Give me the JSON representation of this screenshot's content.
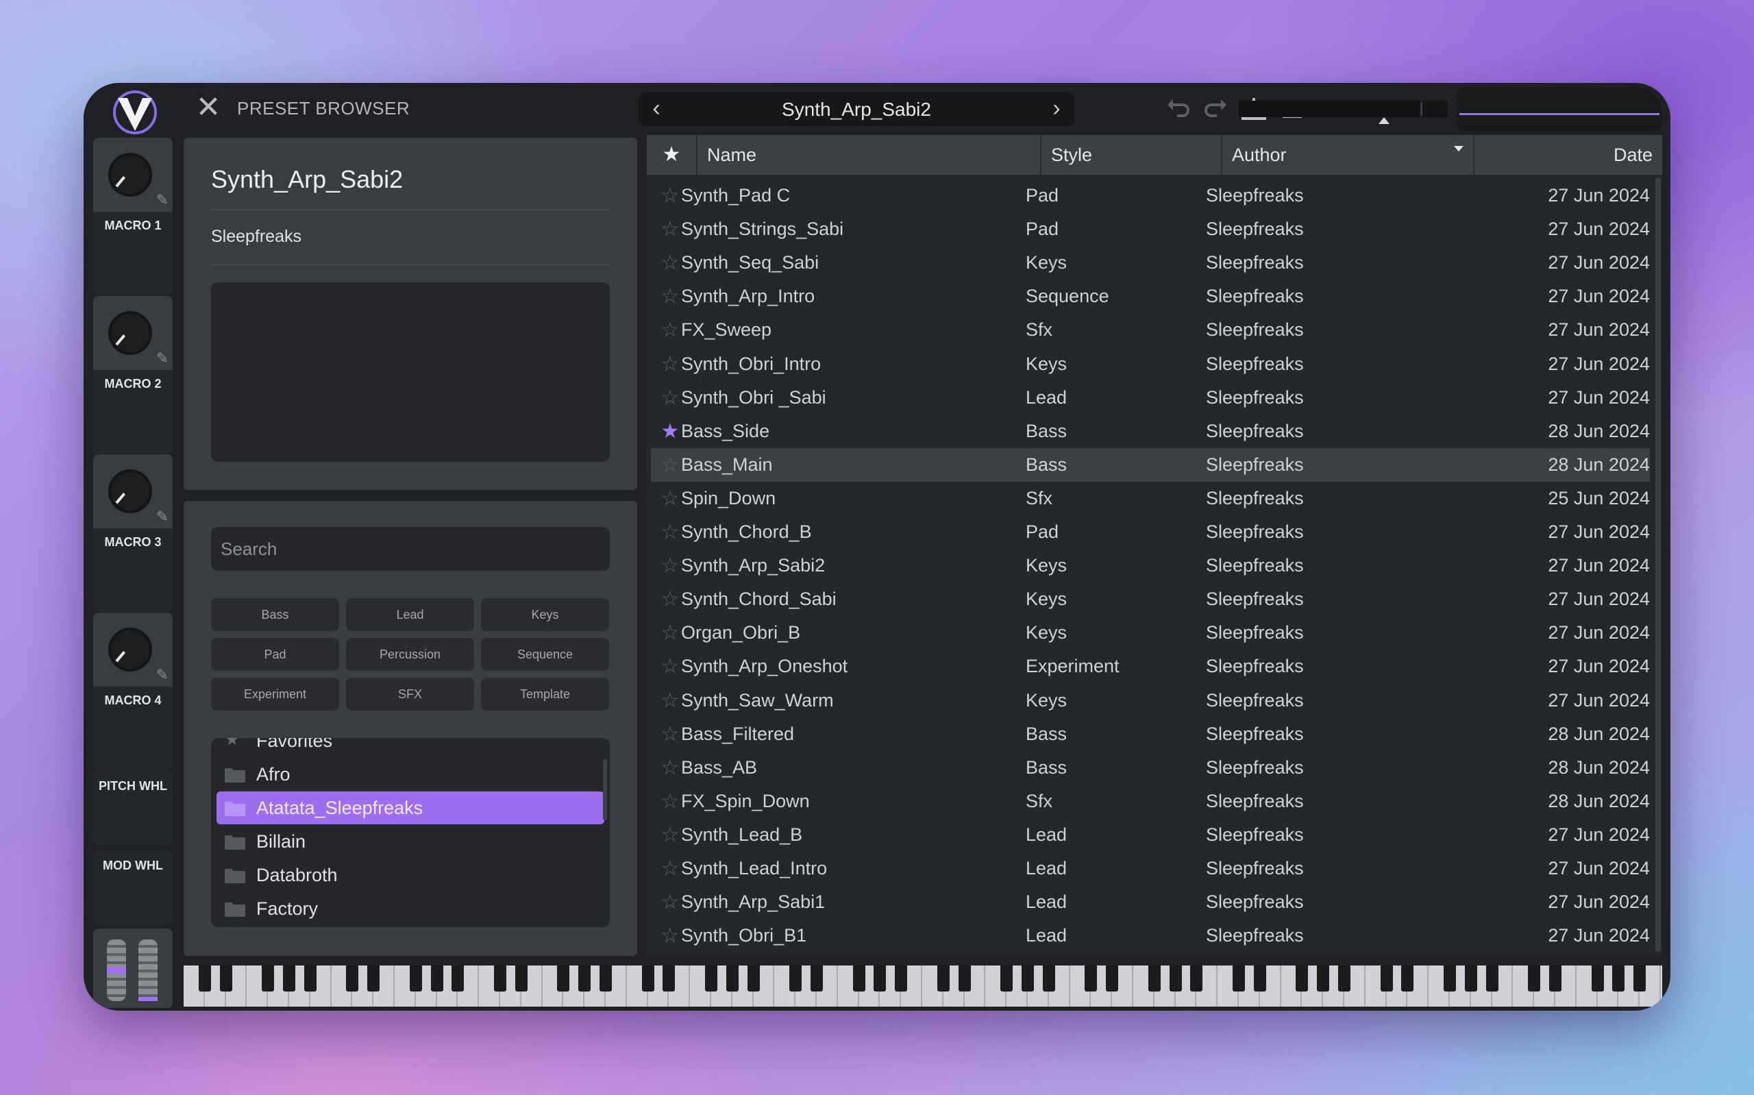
{
  "header": {
    "title": "PRESET BROWSER",
    "current_preset": "Synth_Arp_Sabi2",
    "icons": [
      "logo-icon",
      "close-icon",
      "chevron-left-icon",
      "chevron-right-icon",
      "undo-icon",
      "redo-icon",
      "save-icon",
      "menu-icon"
    ]
  },
  "macros": [
    {
      "label": "MACRO 1"
    },
    {
      "label": "MACRO 2"
    },
    {
      "label": "MACRO 3"
    },
    {
      "label": "MACRO 4"
    }
  ],
  "wheels": {
    "pitch": "PITCH WHL",
    "mod": "MOD WHL"
  },
  "info": {
    "name": "Synth_Arp_Sabi2",
    "author": "Sleepfreaks"
  },
  "search": {
    "placeholder": "Search"
  },
  "tags": [
    "Bass",
    "Lead",
    "Keys",
    "Pad",
    "Percussion",
    "Sequence",
    "Experiment",
    "SFX",
    "Template"
  ],
  "folders": [
    {
      "label": "Favorites",
      "selected": false
    },
    {
      "label": "Afro",
      "selected": false
    },
    {
      "label": "Atatata_Sleepfreaks",
      "selected": true
    },
    {
      "label": "Billain",
      "selected": false
    },
    {
      "label": "Databroth",
      "selected": false
    },
    {
      "label": "Factory",
      "selected": false
    }
  ],
  "table": {
    "columns": {
      "star": "★",
      "name": "Name",
      "style": "Style",
      "author": "Author",
      "date": "Date"
    },
    "rows": [
      {
        "fav": false,
        "name": "Synth_Pad C",
        "style": "Pad",
        "author": "Sleepfreaks",
        "date": "27 Jun 2024"
      },
      {
        "fav": false,
        "name": "Synth_Strings_Sabi",
        "style": "Pad",
        "author": "Sleepfreaks",
        "date": "27 Jun 2024"
      },
      {
        "fav": false,
        "name": "Synth_Seq_Sabi",
        "style": "Keys",
        "author": "Sleepfreaks",
        "date": "27 Jun 2024"
      },
      {
        "fav": false,
        "name": "Synth_Arp_Intro",
        "style": "Sequence",
        "author": "Sleepfreaks",
        "date": "27 Jun 2024"
      },
      {
        "fav": false,
        "name": "FX_Sweep",
        "style": "Sfx",
        "author": "Sleepfreaks",
        "date": "27 Jun 2024"
      },
      {
        "fav": false,
        "name": "Synth_Obri_Intro",
        "style": "Keys",
        "author": "Sleepfreaks",
        "date": "27 Jun 2024"
      },
      {
        "fav": false,
        "name": "Synth_Obri _Sabi",
        "style": "Lead",
        "author": "Sleepfreaks",
        "date": "27 Jun 2024"
      },
      {
        "fav": true,
        "name": "Bass_Side",
        "style": "Bass",
        "author": "Sleepfreaks",
        "date": "28 Jun 2024"
      },
      {
        "fav": false,
        "name": "Bass_Main",
        "style": "Bass",
        "author": "Sleepfreaks",
        "date": "28 Jun 2024",
        "selected": true
      },
      {
        "fav": false,
        "name": "Spin_Down",
        "style": "Sfx",
        "author": "Sleepfreaks",
        "date": "25 Jun 2024"
      },
      {
        "fav": false,
        "name": "Synth_Chord_B",
        "style": "Pad",
        "author": "Sleepfreaks",
        "date": "27 Jun 2024"
      },
      {
        "fav": false,
        "name": "Synth_Arp_Sabi2",
        "style": "Keys",
        "author": "Sleepfreaks",
        "date": "27 Jun 2024"
      },
      {
        "fav": false,
        "name": "Synth_Chord_Sabi",
        "style": "Keys",
        "author": "Sleepfreaks",
        "date": "27 Jun 2024"
      },
      {
        "fav": false,
        "name": "Organ_Obri_B",
        "style": "Keys",
        "author": "Sleepfreaks",
        "date": "27 Jun 2024"
      },
      {
        "fav": false,
        "name": "Synth_Arp_Oneshot",
        "style": "Experiment",
        "author": "Sleepfreaks",
        "date": "27 Jun 2024"
      },
      {
        "fav": false,
        "name": "Synth_Saw_Warm",
        "style": "Keys",
        "author": "Sleepfreaks",
        "date": "27 Jun 2024"
      },
      {
        "fav": false,
        "name": "Bass_Filtered",
        "style": "Bass",
        "author": "Sleepfreaks",
        "date": "28 Jun 2024"
      },
      {
        "fav": false,
        "name": "Bass_AB",
        "style": "Bass",
        "author": "Sleepfreaks",
        "date": "28 Jun 2024"
      },
      {
        "fav": false,
        "name": "FX_Spin_Down",
        "style": "Sfx",
        "author": "Sleepfreaks",
        "date": "28 Jun 2024"
      },
      {
        "fav": false,
        "name": "Synth_Lead_B",
        "style": "Lead",
        "author": "Sleepfreaks",
        "date": "27 Jun 2024"
      },
      {
        "fav": false,
        "name": "Synth_Lead_Intro",
        "style": "Lead",
        "author": "Sleepfreaks",
        "date": "27 Jun 2024"
      },
      {
        "fav": false,
        "name": "Synth_Arp_Sabi1",
        "style": "Lead",
        "author": "Sleepfreaks",
        "date": "27 Jun 2024"
      },
      {
        "fav": false,
        "name": "Synth_Obri_B1",
        "style": "Lead",
        "author": "Sleepfreaks",
        "date": "27 Jun 2024"
      }
    ]
  },
  "colors": {
    "accent": "#9d6ff0",
    "panel": "#3a3d41",
    "background": "#1f2124"
  }
}
